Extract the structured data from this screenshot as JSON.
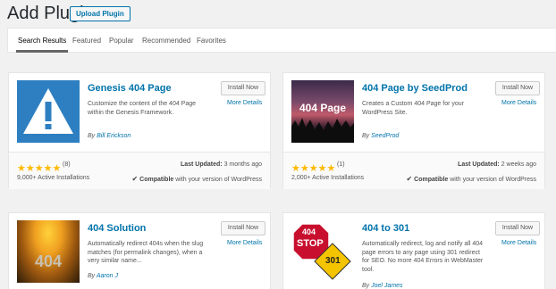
{
  "header": {
    "title": "Add Plugins",
    "upload_label": "Upload Plugin"
  },
  "tabs": [
    {
      "label": "Search Results"
    },
    {
      "label": "Featured"
    },
    {
      "label": "Popular"
    },
    {
      "label": "Recommended"
    },
    {
      "label": "Favorites"
    }
  ],
  "colors": {
    "link": "#0073aa",
    "star": "#ffb900",
    "genesis_bg": "#2e7fc1"
  },
  "plugins": [
    {
      "name": "Genesis 404 Page",
      "install_label": "Install Now",
      "details_label": "More Details",
      "description": "Customize the content of the 404 Page within the Genesis Framework.",
      "author_prefix": "By",
      "author": "Bill Erickson",
      "rating_stars": 5,
      "rating_count": "(8)",
      "installs": "9,000+ Active Installations",
      "updated_label": "Last Updated:",
      "updated_value": "3 months ago",
      "compat_label": "Compatible",
      "compat_suffix": "with your version of WordPress",
      "icon": "warning-triangle-icon"
    },
    {
      "name": "404 Page by SeedProd",
      "install_label": "Install Now",
      "details_label": "More Details",
      "description": "Creates a Custom 404 Page for your WordPress Site.",
      "author_prefix": "By",
      "author": "SeedProd",
      "thumb_text": "404 Page",
      "rating_stars": 5,
      "rating_count": "(1)",
      "installs": "2,000+ Active Installations",
      "updated_label": "Last Updated:",
      "updated_value": "2 weeks ago",
      "compat_label": "Compatible",
      "compat_suffix": "with your version of WordPress"
    },
    {
      "name": "404 Solution",
      "install_label": "Install Now",
      "details_label": "More Details",
      "description": "Automatically redirect 404s when the slug matches (for permalink changes), when a very similar name...",
      "author_prefix": "By",
      "author": "Aaron J",
      "thumb_text": "404"
    },
    {
      "name": "404 to 301",
      "install_label": "Install Now",
      "details_label": "More Details",
      "description": "Automatically redirect, log and notify all 404 page errors to any page using 301 redirect for SEO. No more 404 Errors in WebMaster tool.",
      "author_prefix": "By",
      "author": "Joel James",
      "sign_top": "404",
      "sign_stop": "STOP",
      "sign_arrow": "301"
    }
  ]
}
